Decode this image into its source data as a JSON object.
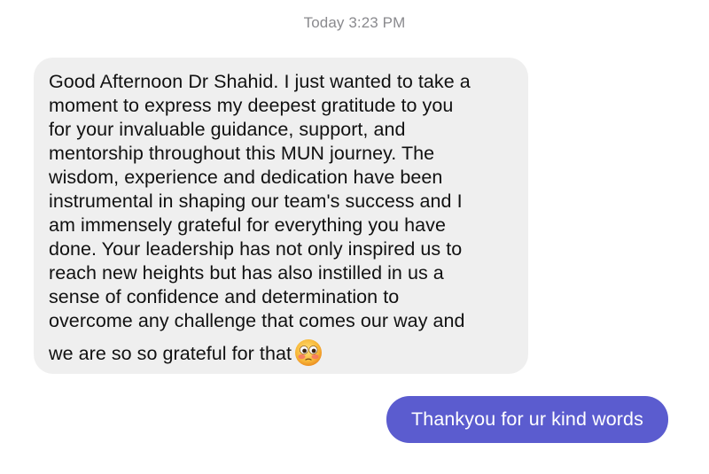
{
  "conversation": {
    "timestamp": "Today 3:23 PM",
    "incoming_message": {
      "lines": [
        "Good Afternoon Dr Shahid. I just wanted to take a",
        "moment to express my deepest gratitude to you",
        "for your invaluable guidance, support, and",
        "mentorship throughout this MUN journey. The",
        "wisdom, experience and dedication have been",
        "instrumental in shaping our team's success and I",
        "am immensely grateful for everything you have",
        "done. Your leadership has not only inspired us to",
        "reach new heights but has also instilled in us a",
        "sense of confidence and determination to",
        "overcome any challenge that comes our way and",
        "we are so so grateful for that"
      ],
      "emoji": "face-with-wide-eyes-emoji",
      "bubble_color": "#efefef"
    },
    "outgoing_message": {
      "text": "Thankyou for ur kind words",
      "bubble_color": "#5b5ccf"
    }
  }
}
